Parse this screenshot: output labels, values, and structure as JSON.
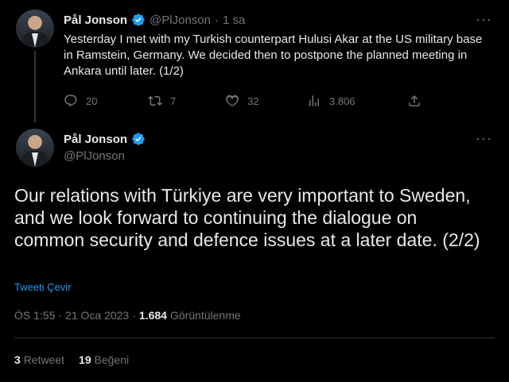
{
  "tweet1": {
    "author_name": "Pål Jonson",
    "handle": "@PlJonson",
    "separator": "·",
    "time": "1 sa",
    "text": "Yesterday I met with my Turkish counterpart Hulusi Akar at the US military base in Ramstein, Germany. We decided then to postpone the planned meeting in Ankara until later. (1/2)",
    "replies": "20",
    "retweets": "7",
    "likes": "32",
    "views": "3.806",
    "more_icon": "more-icon"
  },
  "tweet2": {
    "author_name": "Pål Jonson",
    "handle": "@PlJonson",
    "text": "Our relations with Türkiye are very important to Sweden, and we look forward to continuing the dialogue on common security and defence issues at a later date. (2/2)",
    "translate_label": "Tweeti Çevir",
    "time": "ÖS 1:55",
    "date": "21 Oca 2023",
    "views_count": "1.684",
    "views_label": "Görüntülenme",
    "retweet_count": "3",
    "retweet_label": "Retweet",
    "like_count": "19",
    "like_label": "Beğeni"
  },
  "colors": {
    "background": "#000000",
    "text": "#e7e9ea",
    "muted": "#71767b",
    "accent": "#1d9bf0",
    "divider": "#2f3336"
  }
}
